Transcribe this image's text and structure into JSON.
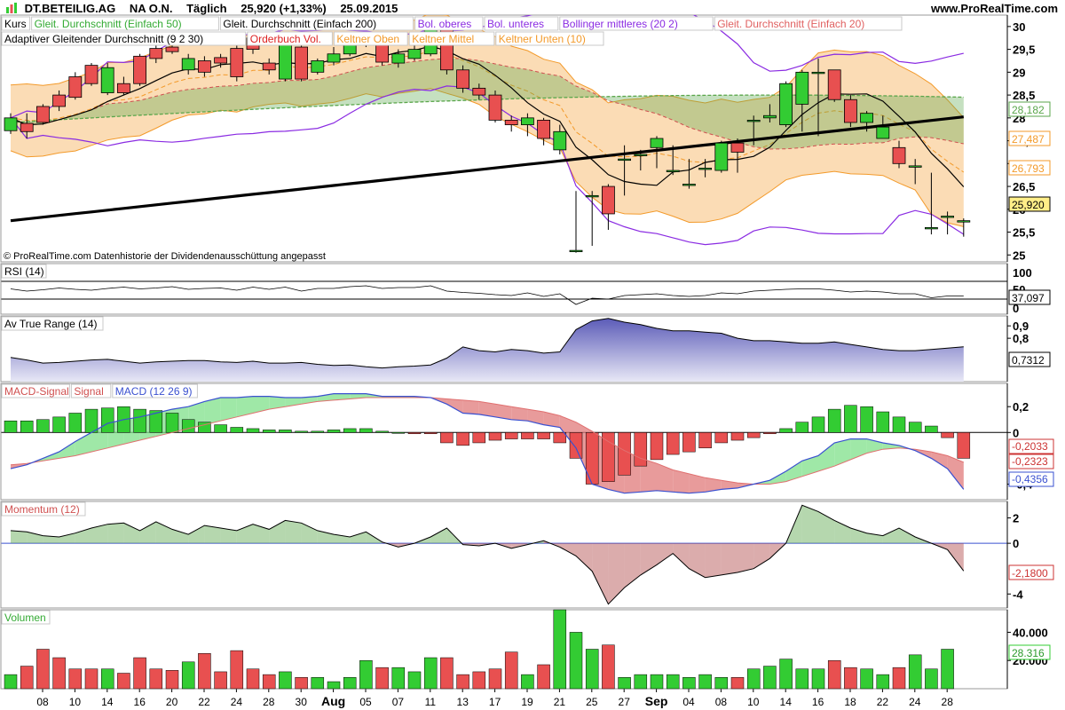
{
  "header": {
    "instrument": "DT.BETEILIG.AG",
    "share_class": "NA O.N.",
    "period": "Täglich",
    "price_change": "25,920 (+1,33%)",
    "date": "25.09.2015",
    "site": "www.ProRealTime.com"
  },
  "copyright": "© ProRealTime.com  Datenhistorie der Dividendenausschüttung angepasst",
  "colors": {
    "up": "#33cc33",
    "down": "#e85050",
    "ma200": "#000000",
    "bollinger": "#8a2be2",
    "keltner": "#f39a2a",
    "ma50": "#5aa64b",
    "macd_line": "#3a50d0",
    "atr_fill": "#7878c8"
  },
  "price_legend_row1": [
    {
      "label": "Kurs",
      "color": "#000000"
    },
    {
      "label": "Gleit. Durchschnitt (Einfach 50)",
      "color": "#33aa33"
    },
    {
      "label": "Gleit. Durchschnitt (Einfach 200)",
      "color": "#000000"
    },
    {
      "label": "Bol. oberes",
      "color": "#8a2be2"
    },
    {
      "label": "Bol. unteres",
      "color": "#8a2be2"
    },
    {
      "label": "Bollinger mittleres (20 2)",
      "color": "#8a2be2"
    },
    {
      "label": "Gleit. Durchschnitt (Einfach 20)",
      "color": "#e06060"
    }
  ],
  "price_legend_row2": [
    {
      "label": "Adaptiver Gleitender Durchschnitt (9 2 30)",
      "color": "#000000"
    },
    {
      "label": "Orderbuch Vol.",
      "color": "#dd2222"
    },
    {
      "label": "Keltner Oben",
      "color": "#f39a2a"
    },
    {
      "label": "Keltner Mittel",
      "color": "#f39a2a"
    },
    {
      "label": "Keltner Unten (10)",
      "color": "#f39a2a"
    }
  ],
  "chart_data": {
    "type": "candlestick",
    "x_tick_labels": [
      "08",
      "10",
      "14",
      "16",
      "20",
      "22",
      "24",
      "28",
      "30",
      "Aug",
      "05",
      "07",
      "11",
      "13",
      "17",
      "19",
      "21",
      "25",
      "27",
      "Sep",
      "04",
      "08",
      "10",
      "14",
      "16",
      "18",
      "22",
      "24",
      "28"
    ],
    "x_tick_label_indices": [
      0,
      2,
      4,
      6,
      8,
      10,
      12,
      14,
      16,
      18,
      20,
      22,
      24,
      26,
      28,
      30,
      32,
      34,
      36,
      38,
      40,
      42,
      44,
      46,
      48,
      50,
      52,
      54,
      56
    ],
    "price": {
      "axis_ticks": [
        25,
        25.5,
        26,
        26.5,
        27,
        27.5,
        28,
        28.5,
        29,
        29.5,
        30
      ],
      "axis_tick_labels": [
        "25",
        "25,5",
        "26",
        "26,5",
        "27",
        "27,5",
        "28",
        "28,5",
        "29",
        "29,5",
        "30"
      ],
      "ylim": [
        24.85,
        30.25
      ],
      "open": [
        27.72,
        27.88,
        28.25,
        28.5,
        28.9,
        29.15,
        28.55,
        28.75,
        29.35,
        29.52,
        29.55,
        29.05,
        29.25,
        29.32,
        29.52,
        29.75,
        29.2,
        28.85,
        29.55,
        29.0,
        29.22,
        29.4,
        29.62,
        29.7,
        29.2,
        29.3,
        29.4,
        29.95,
        29.05,
        28.65,
        28.5,
        27.95,
        27.85,
        27.95,
        27.3,
        25.1,
        26.3,
        26.5,
        27.1,
        27.2,
        27.35,
        26.85,
        26.55,
        26.9,
        26.85,
        27.45,
        27.95,
        28.0,
        27.85,
        28.3,
        29.0,
        29.05,
        28.4,
        27.9,
        27.55,
        27.35,
        26.95,
        25.6,
        25.85
      ],
      "close": [
        28.0,
        27.7,
        27.9,
        28.25,
        28.45,
        28.75,
        29.1,
        28.55,
        28.75,
        29.3,
        29.45,
        29.3,
        29.0,
        29.2,
        28.9,
        29.5,
        29.05,
        29.6,
        28.85,
        29.25,
        29.4,
        29.65,
        29.7,
        29.22,
        29.4,
        29.5,
        29.95,
        29.05,
        28.65,
        28.5,
        27.95,
        27.85,
        28.0,
        27.55,
        27.7,
        25.1,
        26.3,
        25.9,
        27.1,
        27.2,
        27.55,
        26.85,
        26.55,
        26.9,
        27.45,
        27.25,
        27.95,
        28.05,
        28.75,
        29.0,
        29.0,
        28.4,
        27.9,
        28.1,
        27.8,
        27.0,
        26.95,
        25.6,
        25.85,
        25.75
      ],
      "high": [
        28.1,
        28.1,
        28.3,
        28.6,
        29.0,
        29.2,
        29.2,
        28.9,
        29.4,
        29.65,
        29.7,
        29.4,
        29.35,
        29.4,
        29.6,
        29.85,
        29.3,
        29.65,
        29.6,
        29.3,
        29.55,
        29.8,
        29.85,
        29.75,
        29.5,
        29.6,
        30.0,
        30.0,
        29.15,
        28.75,
        28.6,
        28.05,
        28.1,
        28.0,
        27.85,
        26.4,
        26.4,
        26.55,
        27.4,
        27.3,
        27.6,
        27.4,
        27.1,
        27.1,
        27.5,
        27.55,
        28.05,
        28.3,
        28.8,
        29.05,
        29.3,
        29.05,
        28.5,
        28.15,
        28.05,
        27.5,
        27.1,
        26.8,
        25.95,
        25.8
      ],
      "low": [
        27.65,
        27.55,
        27.85,
        28.15,
        28.4,
        28.7,
        28.5,
        28.5,
        28.7,
        29.2,
        29.4,
        28.95,
        28.9,
        29.1,
        28.8,
        29.4,
        28.95,
        28.8,
        28.8,
        28.95,
        29.15,
        29.35,
        29.55,
        29.15,
        29.1,
        29.25,
        29.35,
        28.95,
        28.55,
        28.4,
        27.9,
        27.7,
        27.6,
        27.4,
        27.2,
        25.05,
        25.2,
        25.55,
        26.3,
        26.85,
        26.9,
        26.75,
        26.45,
        26.7,
        26.8,
        26.8,
        27.4,
        27.9,
        27.8,
        27.7,
        27.6,
        28.35,
        27.8,
        27.7,
        27.55,
        26.9,
        26.55,
        25.45,
        25.45,
        25.4
      ],
      "last_value_labels": [
        "28,182",
        "27,487",
        "26,793",
        "25,920"
      ]
    },
    "rsi": {
      "label": "RSI (14)",
      "axis_tick_labels": [
        "100",
        "50",
        "0"
      ],
      "ylim": [
        0,
        100
      ],
      "values": [
        53,
        48,
        51,
        55,
        52,
        50,
        54,
        57,
        53,
        55,
        58,
        52,
        54,
        55,
        50,
        57,
        52,
        57,
        48,
        54,
        54,
        58,
        60,
        54,
        56,
        56,
        60,
        48,
        45,
        43,
        40,
        38,
        44,
        36,
        42,
        18,
        32,
        30,
        38,
        40,
        42,
        38,
        36,
        38,
        44,
        42,
        48,
        50,
        52,
        53,
        53,
        50,
        46,
        48,
        46,
        42,
        42,
        33,
        37,
        37.1
      ],
      "last_value_label": "37,097"
    },
    "atr": {
      "label": "Av True Range (14)",
      "axis_tick_labels": [
        "0,9",
        "0,8"
      ],
      "ylim": [
        0.45,
        0.98
      ],
      "values": [
        0.645,
        0.625,
        0.6,
        0.605,
        0.615,
        0.625,
        0.63,
        0.615,
        0.6,
        0.61,
        0.615,
        0.62,
        0.62,
        0.61,
        0.605,
        0.615,
        0.6,
        0.6,
        0.605,
        0.59,
        0.58,
        0.585,
        0.57,
        0.56,
        0.57,
        0.575,
        0.585,
        0.64,
        0.73,
        0.7,
        0.69,
        0.71,
        0.7,
        0.68,
        0.69,
        0.87,
        0.94,
        0.96,
        0.93,
        0.91,
        0.88,
        0.86,
        0.86,
        0.85,
        0.84,
        0.8,
        0.78,
        0.78,
        0.77,
        0.76,
        0.76,
        0.77,
        0.75,
        0.73,
        0.71,
        0.7,
        0.7,
        0.71,
        0.72,
        0.731
      ],
      "last_value_label": "0,7312"
    },
    "macd": {
      "label_signal": "MACD-Signal",
      "label_hist": "Signal",
      "label_macd": "MACD (12 26 9)",
      "axis_tick_labels": [
        "0,2",
        "0",
        "-0,4"
      ],
      "ylim": [
        -0.52,
        0.38
      ],
      "macd": [
        -0.28,
        -0.25,
        -0.2,
        -0.15,
        -0.07,
        0.0,
        0.07,
        0.1,
        0.12,
        0.15,
        0.18,
        0.2,
        0.24,
        0.27,
        0.27,
        0.28,
        0.28,
        0.27,
        0.27,
        0.28,
        0.3,
        0.3,
        0.3,
        0.28,
        0.28,
        0.28,
        0.27,
        0.22,
        0.15,
        0.14,
        0.12,
        0.1,
        0.09,
        0.06,
        0.04,
        -0.12,
        -0.4,
        -0.44,
        -0.47,
        -0.46,
        -0.45,
        -0.46,
        -0.47,
        -0.46,
        -0.44,
        -0.43,
        -0.4,
        -0.37,
        -0.3,
        -0.22,
        -0.18,
        -0.08,
        -0.05,
        -0.05,
        -0.08,
        -0.1,
        -0.14,
        -0.2,
        -0.28,
        -0.44
      ],
      "signal": [
        -0.25,
        -0.24,
        -0.22,
        -0.2,
        -0.18,
        -0.15,
        -0.12,
        -0.09,
        -0.06,
        -0.03,
        0.0,
        0.03,
        0.06,
        0.09,
        0.12,
        0.15,
        0.18,
        0.2,
        0.22,
        0.24,
        0.25,
        0.26,
        0.27,
        0.27,
        0.27,
        0.27,
        0.27,
        0.26,
        0.25,
        0.24,
        0.22,
        0.2,
        0.18,
        0.16,
        0.13,
        0.08,
        0.01,
        -0.07,
        -0.14,
        -0.2,
        -0.24,
        -0.29,
        -0.32,
        -0.35,
        -0.37,
        -0.39,
        -0.4,
        -0.4,
        -0.38,
        -0.34,
        -0.3,
        -0.26,
        -0.21,
        -0.16,
        -0.13,
        -0.12,
        -0.13,
        -0.15,
        -0.18,
        -0.23
      ],
      "histogram": [
        0.09,
        0.09,
        0.1,
        0.12,
        0.15,
        0.18,
        0.19,
        0.2,
        0.18,
        0.17,
        0.15,
        0.1,
        0.08,
        0.06,
        0.04,
        0.03,
        0.02,
        0.02,
        0.01,
        0.01,
        0.02,
        0.03,
        0.03,
        0.01,
        0.0,
        -0.01,
        -0.01,
        -0.08,
        -0.1,
        -0.08,
        -0.06,
        -0.05,
        -0.05,
        -0.05,
        -0.08,
        -0.2,
        -0.4,
        -0.38,
        -0.33,
        -0.26,
        -0.21,
        -0.17,
        -0.15,
        -0.12,
        -0.08,
        -0.06,
        -0.04,
        -0.01,
        0.03,
        0.08,
        0.12,
        0.18,
        0.21,
        0.2,
        0.16,
        0.12,
        0.08,
        0.05,
        -0.04,
        -0.2
      ],
      "last_value_labels": [
        "-0,2033",
        "-0,2323",
        "-0,4356"
      ]
    },
    "momentum": {
      "label": "Momentum (12)",
      "axis_tick_labels": [
        "2",
        "0",
        "-4"
      ],
      "ylim": [
        -5.1,
        3.3
      ],
      "values": [
        1.0,
        0.9,
        0.6,
        0.5,
        0.8,
        1.2,
        1.5,
        1.6,
        1.0,
        1.7,
        1.1,
        0.7,
        1.4,
        1.2,
        1.0,
        1.5,
        1.1,
        1.8,
        1.6,
        1.0,
        0.7,
        0.5,
        0.9,
        0.1,
        -0.3,
        0.0,
        0.5,
        1.2,
        -0.1,
        -0.2,
        0.0,
        -0.4,
        -0.1,
        0.2,
        -0.3,
        -1.0,
        -2.2,
        -4.8,
        -3.5,
        -2.5,
        -1.7,
        -0.8,
        -2.0,
        -2.7,
        -2.5,
        -2.3,
        -2.0,
        -1.2,
        0.0,
        3.0,
        2.5,
        1.8,
        1.2,
        0.8,
        0.6,
        1.2,
        0.5,
        0.0,
        -0.5,
        -2.18
      ],
      "last_value_label": "-2,1800"
    },
    "volume": {
      "label": "Volumen",
      "axis_tick_labels": [
        "40.000",
        "20.000"
      ],
      "ylim": [
        0,
        56000
      ],
      "values": [
        10000,
        16000,
        28000,
        22000,
        14000,
        14000,
        14000,
        11000,
        22000,
        14000,
        13000,
        19000,
        25000,
        12000,
        27000,
        14000,
        10000,
        12000,
        8000,
        8000,
        5000,
        8000,
        20000,
        15000,
        15000,
        12000,
        22000,
        22000,
        10000,
        12000,
        14000,
        26000,
        10000,
        17000,
        56000,
        40000,
        28000,
        31000,
        8000,
        10000,
        10000,
        10000,
        8000,
        10000,
        8000,
        8000,
        14000,
        16000,
        21000,
        14000,
        14000,
        20000,
        15000,
        14000,
        10000,
        15000,
        24000,
        14000,
        28000
      ],
      "last_value_label": "28.316"
    }
  }
}
